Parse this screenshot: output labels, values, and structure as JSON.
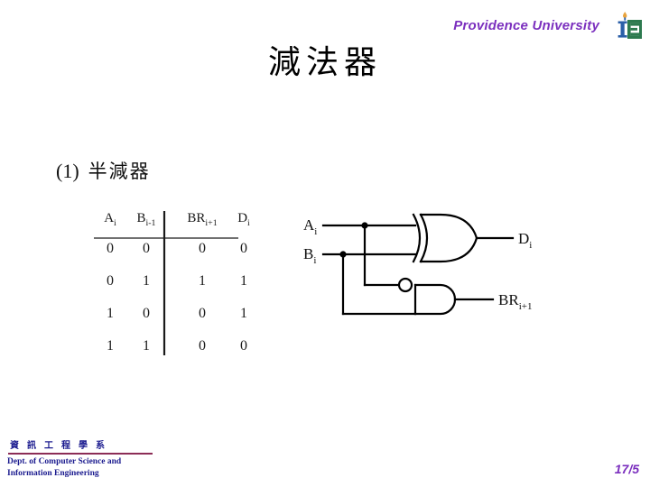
{
  "header": {
    "university": "Providence University",
    "logo_name": "providence-university-logo",
    "logo_colors": {
      "crescent": "#C8BC93",
      "letter_i": "#2B5FA8",
      "letter_e": "#2D7A4F",
      "flame": "#E8A33D"
    },
    "accent_color": "#7B2FBE"
  },
  "title": "減法器",
  "section": {
    "number": "(1)",
    "label": "半減器"
  },
  "truth_table": {
    "headers": [
      "A i",
      "B i-1",
      "BR i+1",
      "D i"
    ],
    "header_parts": [
      {
        "base": "A",
        "sub": "i"
      },
      {
        "base": "B",
        "sub": "i-1"
      },
      {
        "base": "BR",
        "sub": "i+1"
      },
      {
        "base": "D",
        "sub": "i"
      }
    ],
    "rows": [
      [
        "0",
        "0",
        "0",
        "0"
      ],
      [
        "0",
        "1",
        "1",
        "1"
      ],
      [
        "1",
        "0",
        "0",
        "1"
      ],
      [
        "1",
        "1",
        "0",
        "0"
      ]
    ]
  },
  "circuit": {
    "inputs": [
      {
        "base": "A",
        "sub": "i"
      },
      {
        "base": "B",
        "sub": "i"
      }
    ],
    "outputs": [
      {
        "base": "D",
        "sub": "i"
      },
      {
        "base": "BR",
        "sub": "i+1"
      }
    ],
    "gates": [
      {
        "type": "xor",
        "output": "D i"
      },
      {
        "type": "and-with-inverted-input",
        "output": "BR i+1"
      }
    ],
    "line_color": "#000000"
  },
  "footer": {
    "dept_cjk": "資訊工程學系",
    "dept_en_line1": "Dept. of Computer Science and",
    "dept_en_line2": "Information Engineering",
    "rule_color": "#8C2D56",
    "text_color": "#1B1B8F"
  },
  "page_number": "17/5"
}
